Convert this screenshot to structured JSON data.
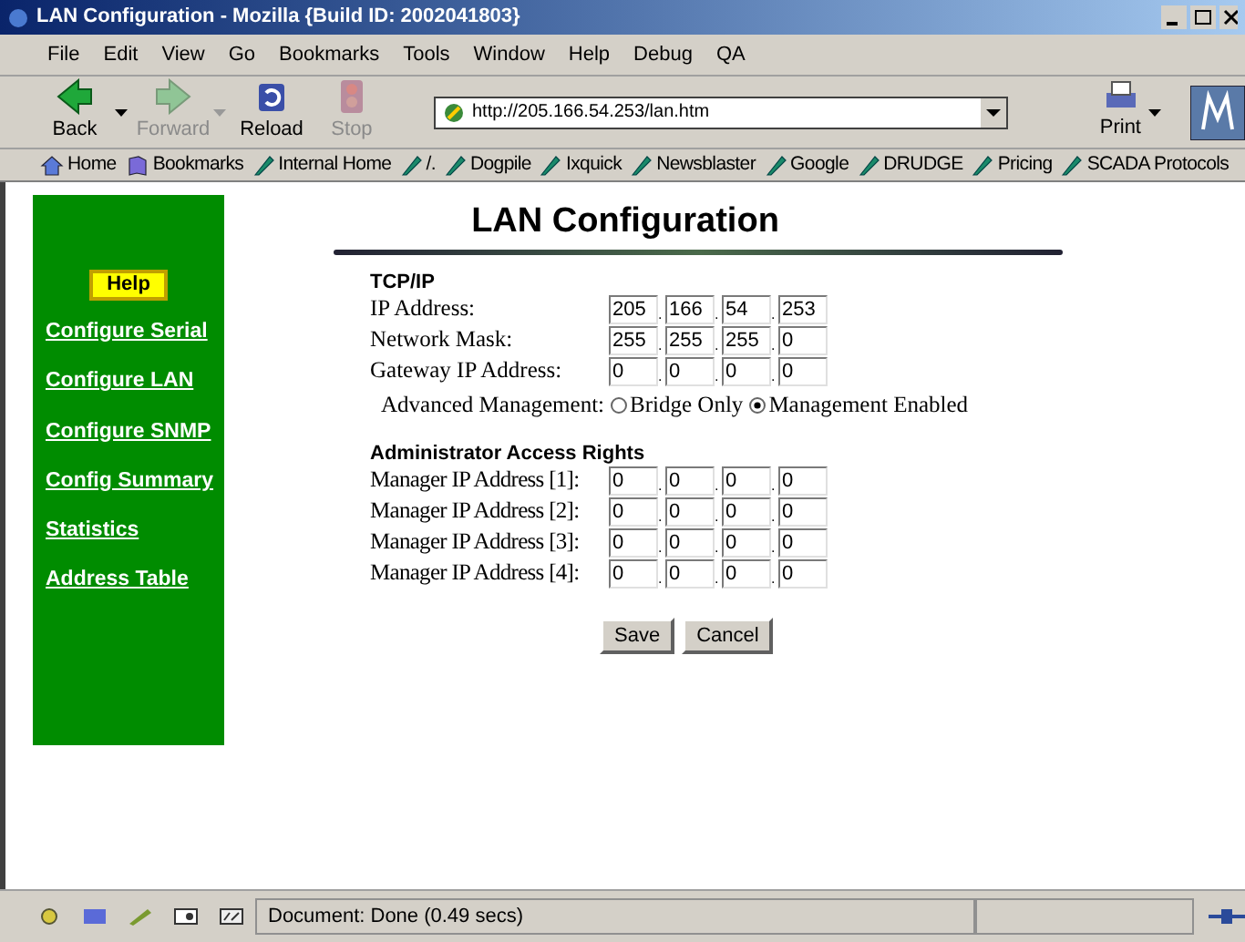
{
  "window": {
    "title": "LAN Configuration - Mozilla {Build ID: 2002041803}"
  },
  "menu": [
    "File",
    "Edit",
    "View",
    "Go",
    "Bookmarks",
    "Tools",
    "Window",
    "Help",
    "Debug",
    "QA"
  ],
  "toolbar": [
    {
      "kind": "back",
      "label": "Back",
      "disabled": false,
      "dropdown": true
    },
    {
      "kind": "forward",
      "label": "Forward",
      "disabled": true,
      "dropdown": true
    },
    {
      "kind": "reload",
      "label": "Reload",
      "disabled": false,
      "dropdown": false
    },
    {
      "kind": "stop",
      "label": "Stop",
      "disabled": true,
      "dropdown": false
    }
  ],
  "address": {
    "value": "http://205.166.54.253/lan.htm"
  },
  "print": {
    "label": "Print"
  },
  "personal_toolbar": [
    {
      "kind": "home",
      "label": "Home"
    },
    {
      "kind": "bookmarks",
      "label": "Bookmarks"
    },
    {
      "kind": "link",
      "label": "Internal Home"
    },
    {
      "kind": "link",
      "label": "/."
    },
    {
      "kind": "link",
      "label": "Dogpile"
    },
    {
      "kind": "link",
      "label": "Ixquick"
    },
    {
      "kind": "link",
      "label": "Newsblaster"
    },
    {
      "kind": "link",
      "label": "Google"
    },
    {
      "kind": "link",
      "label": "DRUDGE"
    },
    {
      "kind": "link",
      "label": "Pricing"
    },
    {
      "kind": "link",
      "label": "SCADA Protocols"
    }
  ],
  "sidebar": {
    "help": "Help",
    "items": [
      "Configure Serial",
      "Configure LAN",
      "Configure SNMP",
      "Config Summary",
      "Statistics",
      "Address Table"
    ]
  },
  "page": {
    "title": "LAN Configuration",
    "sections": [
      {
        "heading": "TCP/IP",
        "rows": [
          {
            "label": "IP Address:",
            "octets": [
              "205",
              "166",
              "54",
              "253"
            ]
          },
          {
            "label": "Network Mask:",
            "octets": [
              "255",
              "255",
              "255",
              "0"
            ]
          },
          {
            "label": "Gateway IP Address:",
            "octets": [
              "0",
              "0",
              "0",
              "0"
            ]
          }
        ]
      },
      {
        "heading": "Administrator Access Rights",
        "rows": [
          {
            "label": "Manager IP Address [1]:",
            "octets": [
              "0",
              "0",
              "0",
              "0"
            ]
          },
          {
            "label": "Manager IP Address [2]:",
            "octets": [
              "0",
              "0",
              "0",
              "0"
            ]
          },
          {
            "label": "Manager IP Address [3]:",
            "octets": [
              "0",
              "0",
              "0",
              "0"
            ]
          },
          {
            "label": "Manager IP Address [4]:",
            "octets": [
              "0",
              "0",
              "0",
              "0"
            ]
          }
        ]
      }
    ],
    "separator": ".",
    "advanced": {
      "label": "Advanced Management:",
      "options": [
        {
          "label": "Bridge Only",
          "selected": false
        },
        {
          "label": "Management Enabled",
          "selected": true
        }
      ]
    },
    "buttons": [
      "Save",
      "Cancel"
    ]
  },
  "status_bar": {
    "text": "Document: Done (0.49 secs)"
  }
}
